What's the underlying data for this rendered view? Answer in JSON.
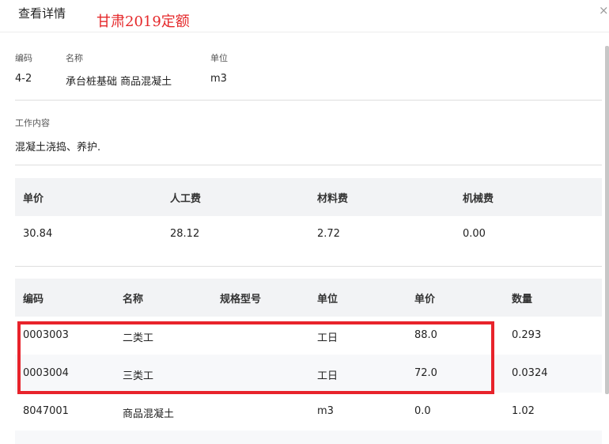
{
  "header": {
    "title": "查看详情",
    "annotation": "甘肃2019定额",
    "close_glyph": "×"
  },
  "item": {
    "code_label": "编码",
    "name_label": "名称",
    "unit_label": "单位",
    "code": "4-2",
    "name": "承台桩基础 商品混凝土",
    "unit": "m3"
  },
  "work": {
    "label": "工作内容",
    "content": "混凝土浇捣、养护."
  },
  "summary": {
    "headers": [
      "单价",
      "人工费",
      "材料费",
      "机械费"
    ],
    "values": [
      "30.84",
      "28.12",
      "2.72",
      "0.00"
    ]
  },
  "resources": {
    "headers": [
      "编码",
      "名称",
      "规格型号",
      "单位",
      "单价",
      "数量"
    ],
    "rows": [
      [
        "0003003",
        "二类工",
        "",
        "工日",
        "88.0",
        "0.293"
      ],
      [
        "0003004",
        "三类工",
        "",
        "工日",
        "72.0",
        "0.0324"
      ],
      [
        "8047001",
        "商品混凝土",
        "",
        "m3",
        "0.0",
        "1.02"
      ]
    ]
  },
  "colors": {
    "highlight": "#e8232b",
    "annotation": "#e5292b",
    "header_bg": "#f2f3f5"
  }
}
